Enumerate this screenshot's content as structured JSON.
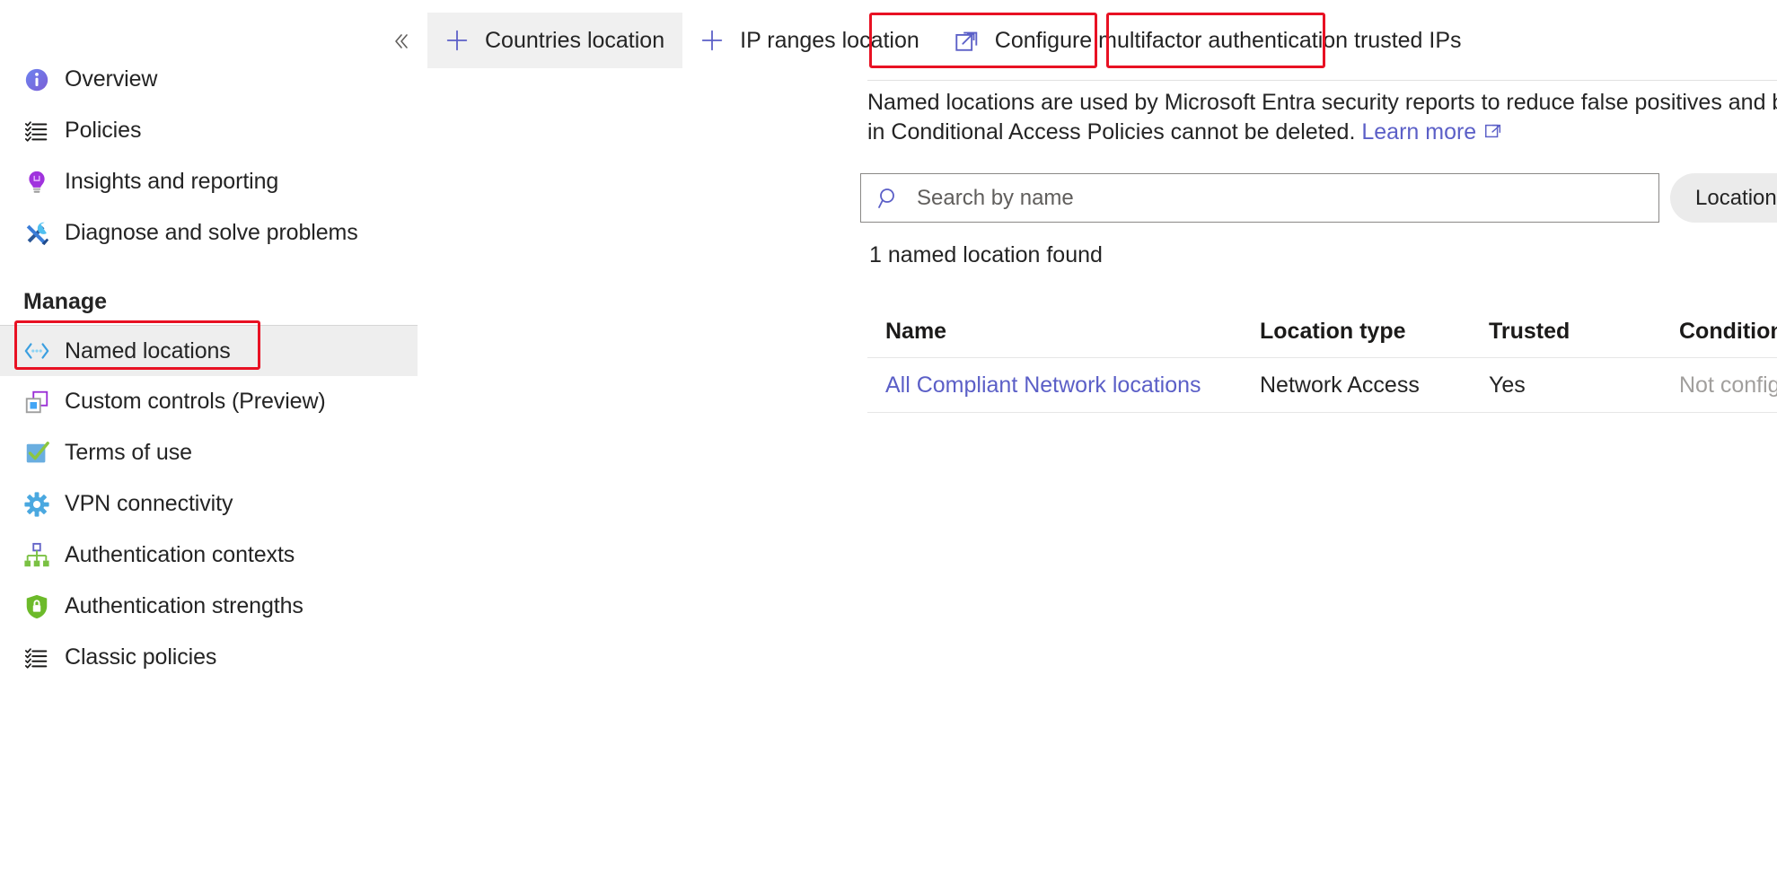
{
  "sidebar": {
    "collapse_icon": "chevron-double-left-icon",
    "items": [
      {
        "label": "Overview",
        "icon": "info-circle-icon"
      },
      {
        "label": "Policies",
        "icon": "checklist-icon"
      },
      {
        "label": "Insights and reporting",
        "icon": "lightbulb-icon"
      },
      {
        "label": "Diagnose and solve problems",
        "icon": "wrench-screwdriver-icon"
      }
    ],
    "section_manage": "Manage",
    "manage_items": [
      {
        "label": "Named locations",
        "icon": "named-locations-icon",
        "selected": true
      },
      {
        "label": "Custom controls (Preview)",
        "icon": "custom-controls-icon",
        "selected": false
      },
      {
        "label": "Terms of use",
        "icon": "checkbox-checked-icon",
        "selected": false
      },
      {
        "label": "VPN connectivity",
        "icon": "gear-icon",
        "selected": false
      },
      {
        "label": "Authentication contexts",
        "icon": "hierarchy-icon",
        "selected": false
      },
      {
        "label": "Authentication strengths",
        "icon": "shield-lock-icon",
        "selected": false
      },
      {
        "label": "Classic policies",
        "icon": "checklist-icon",
        "selected": false
      }
    ]
  },
  "toolbar": {
    "countries_location": "Countries location",
    "ip_ranges_location": "IP ranges location",
    "configure_mfa_trusted_ips": "Configure multifactor authentication trusted IPs",
    "plus_icon": "plus-icon",
    "external_link_icon": "external-link-icon"
  },
  "description": {
    "line1": "Named locations are used by Microsoft Entra security reports to reduce false positives and by Microsoft E",
    "line2": "in Conditional Access Policies cannot be deleted.",
    "learn_more": "Learn more",
    "learn_more_icon": "external-link-icon"
  },
  "search": {
    "placeholder": "Search by name",
    "value": "",
    "icon": "search-icon",
    "filter_pill": "Location type: A"
  },
  "result_count": "1 named location found",
  "table": {
    "columns": [
      "Name",
      "Location type",
      "Trusted",
      "Conditional A"
    ],
    "rows": [
      {
        "name": "All Compliant Network locations",
        "location_type": "Network Access",
        "trusted": "Yes",
        "conditional_access": "Not configure"
      }
    ]
  },
  "colors": {
    "accent": "#5b5fc7",
    "highlight_box": "#e81123",
    "selected_bg": "#eeeeee",
    "muted_text": "#a19f9d"
  }
}
